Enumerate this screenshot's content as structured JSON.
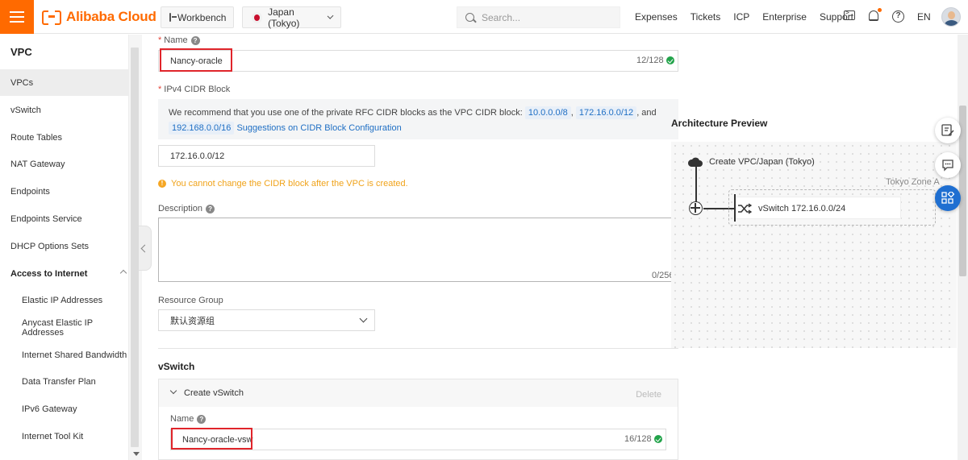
{
  "topbar": {
    "brand": "Alibaba Cloud",
    "workbench": "Workbench",
    "region": "Japan (Tokyo)",
    "search_placeholder": "Search...",
    "links": [
      "Expenses",
      "Tickets",
      "ICP",
      "Enterprise",
      "Support"
    ],
    "language": "EN",
    "accent_color": "#ff6a00"
  },
  "sidebar": {
    "title": "VPC",
    "items": [
      {
        "label": "VPCs",
        "active": true
      },
      {
        "label": "vSwitch"
      },
      {
        "label": "Route Tables"
      },
      {
        "label": "NAT Gateway"
      },
      {
        "label": "Endpoints"
      },
      {
        "label": "Endpoints Service"
      },
      {
        "label": "DHCP Options Sets"
      }
    ],
    "group": "Access to Internet",
    "sub_items": [
      "Elastic IP Addresses",
      "Anycast Elastic IP Addresses",
      "Internet Shared Bandwidth",
      "Data Transfer Plan",
      "IPv6 Gateway",
      "Internet Tool Kit"
    ]
  },
  "form": {
    "name_label": "Name",
    "name_value": "Nancy-oracle",
    "name_counter": "12/128",
    "cidr_label": "IPv4 CIDR Block",
    "cidr_notice_text": "We recommend that you use one of the private RFC CIDR blocks as the VPC CIDR block:",
    "cidr_chips": [
      "10.0.0.0/8",
      "172.16.0.0/12",
      "192.168.0.0/16"
    ],
    "cidr_and": ", and",
    "cidr_link": "Suggestions on CIDR Block Configuration",
    "cidr_value": "172.16.0.0/12",
    "cidr_warning": "You cannot change the CIDR block after the VPC is created.",
    "description_label": "Description",
    "description_counter": "0/256",
    "resource_group_label": "Resource Group",
    "resource_group_value": "默认资源组"
  },
  "vswitch": {
    "section_title": "vSwitch",
    "panel_title": "Create vSwitch",
    "delete_label": "Delete",
    "name_label": "Name",
    "name_value": "Nancy-oracle-vsw",
    "name_counter": "16/128"
  },
  "architecture": {
    "title": "Architecture Preview",
    "vpc_label": "Create VPC/Japan (Tokyo)",
    "zone_label": "Tokyo Zone A",
    "vswitch_label": "vSwitch 172.16.0.0/24"
  }
}
